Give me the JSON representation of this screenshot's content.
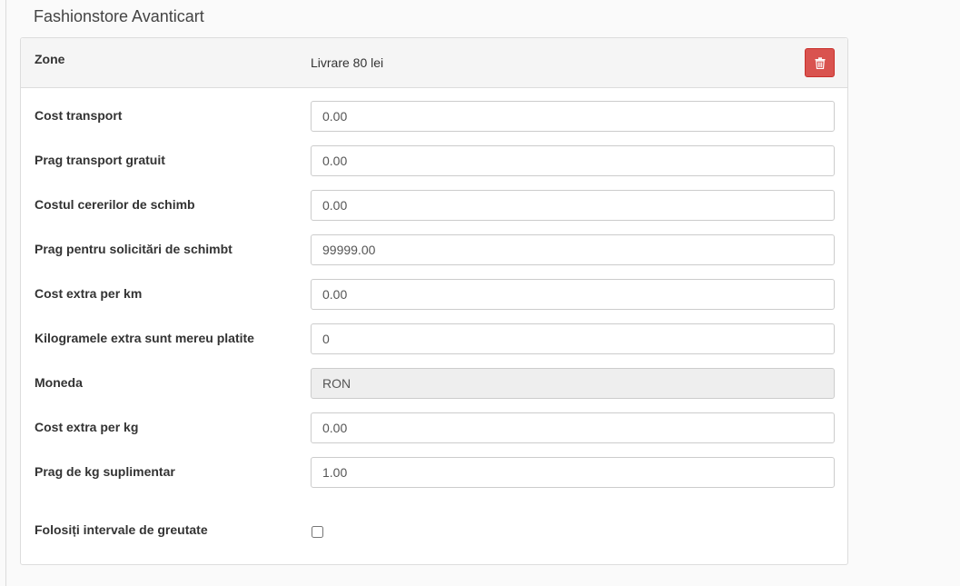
{
  "store": {
    "title": "Fashionstore Avanticart"
  },
  "zone": {
    "label": "Zone",
    "value": "Livrare 80 lei",
    "delete_icon": "trash-icon"
  },
  "fields": [
    {
      "name": "cost-transport",
      "label": "Cost transport",
      "value": "0.00"
    },
    {
      "name": "prag-transport-gratuit",
      "label": "Prag transport gratuit",
      "value": "0.00"
    },
    {
      "name": "costul-cererilor-de-schimb",
      "label": "Costul cererilor de schimb",
      "value": "0.00"
    },
    {
      "name": "prag-solicitari-schimb",
      "label": "Prag pentru solicitări de schimbt",
      "value": "99999.00"
    },
    {
      "name": "cost-extra-per-km",
      "label": "Cost extra per km",
      "value": "0.00"
    },
    {
      "name": "kilogramele-extra",
      "label": "Kilogramele extra sunt mereu platite",
      "value": "0"
    },
    {
      "name": "moneda",
      "label": "Moneda",
      "value": "RON",
      "readonly": true
    },
    {
      "name": "cost-extra-per-kg",
      "label": "Cost extra per kg",
      "value": "0.00"
    },
    {
      "name": "prag-kg-suplimentar",
      "label": "Prag de kg suplimentar",
      "value": "1.00"
    }
  ],
  "weight_intervals": {
    "label": "Folosiți intervale de greutate",
    "checked": false
  },
  "colors": {
    "danger": "#d9534f",
    "border": "#dddddd",
    "readonly_bg": "#eeeeee"
  }
}
